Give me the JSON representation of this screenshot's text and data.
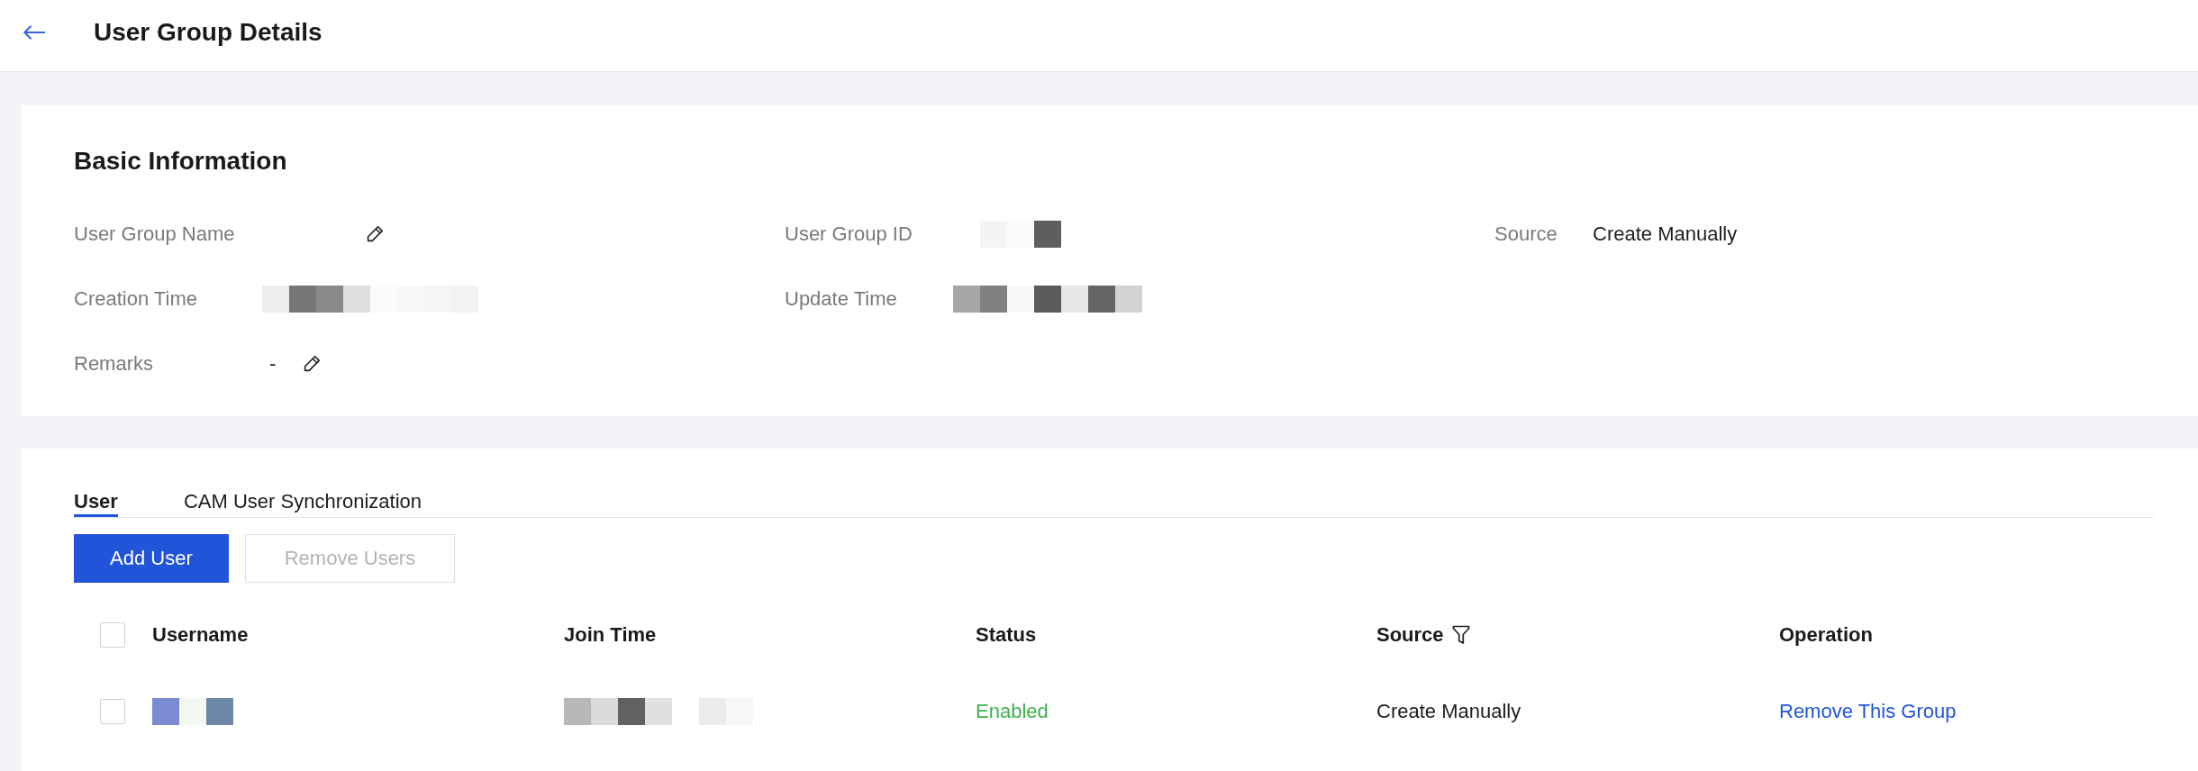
{
  "header": {
    "title": "User Group Details"
  },
  "basic_info": {
    "title": "Basic Information",
    "rows": [
      [
        {
          "label": "User Group Name",
          "kind": "blank",
          "editable": true
        },
        {
          "label": "User Group ID",
          "kind": "redacted",
          "editable": false
        },
        {
          "label": "Source",
          "kind": "text",
          "value": "Create Manually",
          "editable": false
        }
      ],
      [
        {
          "label": "Creation Time",
          "kind": "redacted",
          "editable": false
        },
        {
          "label": "Update Time",
          "kind": "redacted",
          "editable": false
        }
      ],
      [
        {
          "label": "Remarks",
          "kind": "text",
          "value": "-",
          "editable": true
        }
      ]
    ]
  },
  "tabs": [
    {
      "label": "User",
      "selected": true
    },
    {
      "label": "CAM User Synchronization",
      "selected": false
    }
  ],
  "buttons": [
    {
      "label": "Add User",
      "kind": "primary",
      "disabled": false
    },
    {
      "label": "Remove Users",
      "kind": "default",
      "disabled": true
    }
  ],
  "table": {
    "select_all": {
      "checked": false
    },
    "columns": [
      {
        "label": "Username",
        "filter": false
      },
      {
        "label": "Join Time",
        "filter": false
      },
      {
        "label": "Status",
        "filter": false
      },
      {
        "label": "Source",
        "filter": true
      },
      {
        "label": "Operation",
        "filter": false
      }
    ],
    "rows": [
      {
        "checked": false,
        "cells": [
          {
            "kind": "redacted"
          },
          {
            "kind": "redacted"
          },
          {
            "kind": "status",
            "text": "Enabled"
          },
          {
            "kind": "text",
            "text": "Create Manually"
          },
          {
            "kind": "link",
            "text": "Remove This Group"
          }
        ]
      }
    ]
  }
}
